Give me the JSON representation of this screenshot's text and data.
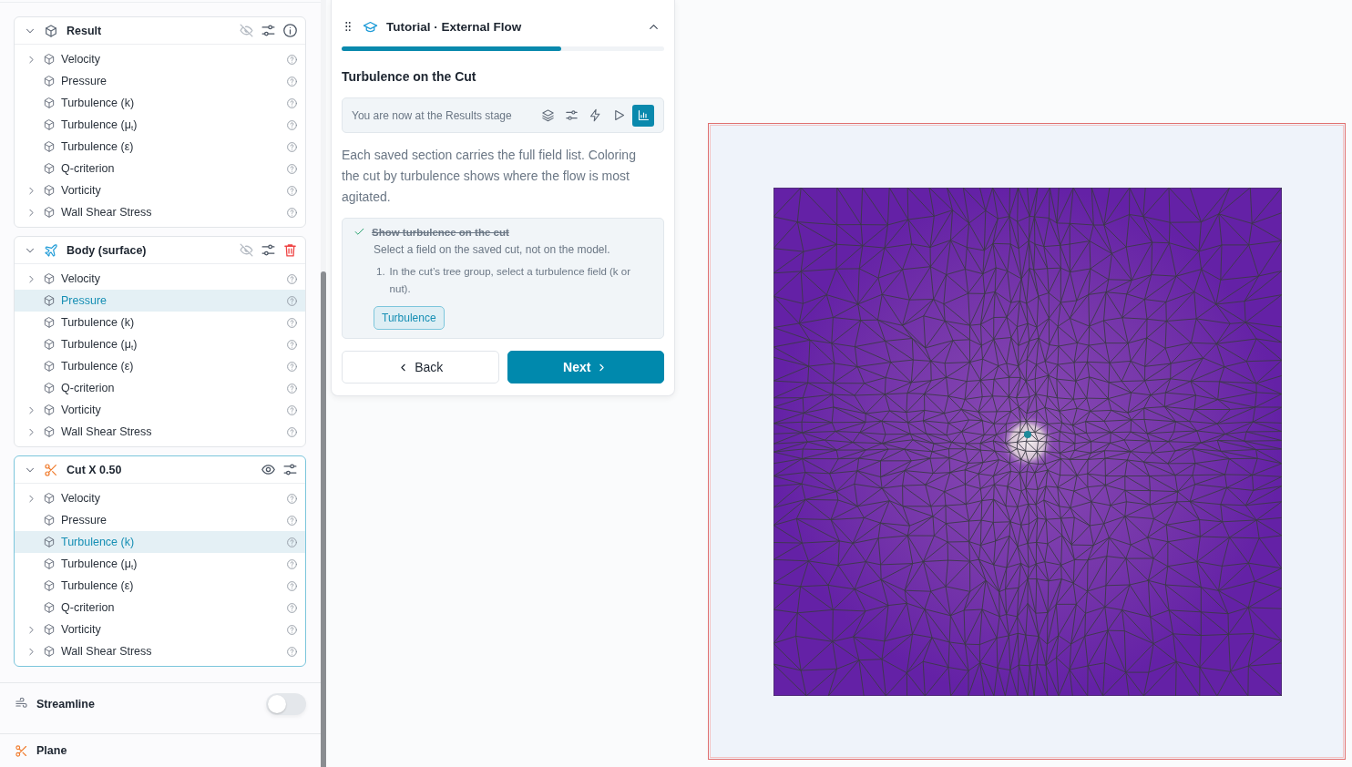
{
  "tree_groups": [
    {
      "kind": "result",
      "title": "Result",
      "expanded": true,
      "active": false,
      "visible": false,
      "actions": [
        {
          "kind": "info"
        }
      ],
      "items": [
        {
          "label": "Velocity",
          "kind": "group",
          "selected": false
        },
        {
          "label": "Pressure",
          "kind": "field",
          "selected": false
        },
        {
          "label": "Turbulence (k)",
          "kind": "field",
          "selected": false
        },
        {
          "label": "Turbulence (μ$_{t}$)",
          "kind": "field",
          "selected": false
        },
        {
          "label": "Turbulence (ε)",
          "kind": "field",
          "selected": false
        },
        {
          "label": "Q-criterion",
          "kind": "field",
          "selected": false
        },
        {
          "label": "Vorticity",
          "kind": "group",
          "selected": false
        },
        {
          "label": "Wall Shear Stress",
          "kind": "group",
          "selected": false
        }
      ]
    },
    {
      "kind": "body",
      "title": "Body (surface)",
      "expanded": true,
      "active": false,
      "visible": false,
      "actions": [
        {
          "kind": "delete"
        }
      ],
      "items": [
        {
          "label": "Velocity",
          "kind": "group",
          "selected": false
        },
        {
          "label": "Pressure",
          "kind": "field",
          "selected": true
        },
        {
          "label": "Turbulence (k)",
          "kind": "field",
          "selected": false
        },
        {
          "label": "Turbulence (μ$_{t}$)",
          "kind": "field",
          "selected": false
        },
        {
          "label": "Turbulence (ε)",
          "kind": "field",
          "selected": false
        },
        {
          "label": "Q-criterion",
          "kind": "field",
          "selected": false
        },
        {
          "label": "Vorticity",
          "kind": "group",
          "selected": false
        },
        {
          "label": "Wall Shear Stress",
          "kind": "group",
          "selected": false
        }
      ]
    },
    {
      "kind": "cut",
      "title": "Cut X 0.50",
      "expanded": true,
      "active": true,
      "visible": true,
      "items": [
        {
          "label": "Velocity",
          "kind": "group",
          "selected": false
        },
        {
          "label": "Pressure",
          "kind": "field",
          "selected": false
        },
        {
          "label": "Turbulence (k)",
          "kind": "field",
          "selected": true
        },
        {
          "label": "Turbulence (μ$_{t}$)",
          "kind": "field",
          "selected": false
        },
        {
          "label": "Turbulence (ε)",
          "kind": "field",
          "selected": false
        },
        {
          "label": "Q-criterion",
          "kind": "field",
          "selected": false
        },
        {
          "label": "Vorticity",
          "kind": "group",
          "selected": false
        },
        {
          "label": "Wall Shear Stress",
          "kind": "group",
          "selected": false
        }
      ]
    }
  ],
  "streamline": {
    "label": "Streamline",
    "on": false
  },
  "plane": {
    "label": "Plane"
  },
  "tutorial": {
    "title": "Tutorial · External Flow",
    "expanded": true,
    "level": 0.68,
    "heading": "Turbulence on the Cut",
    "stage_text": "You are now at the Results stage",
    "stages": [
      {
        "kind": "layers",
        "selected": false
      },
      {
        "kind": "sliders",
        "selected": false
      },
      {
        "kind": "bolt",
        "selected": false
      },
      {
        "kind": "play",
        "selected": false
      },
      {
        "kind": "chart",
        "selected": true
      }
    ],
    "body": "Each saved section carries the full field list. Coloring the cut by turbulence shows where the flow is most agitated.",
    "task": {
      "title": "Show turbulence on the cut",
      "done": true,
      "hint": "Select a field on the saved cut, not on the model.",
      "steps": [
        {
          "number": "1.",
          "text": "In the cut’s tree group, select a turbulence field (k or nut)."
        }
      ],
      "chip": "Turbulence"
    },
    "back": "Back",
    "next": "Next"
  }
}
